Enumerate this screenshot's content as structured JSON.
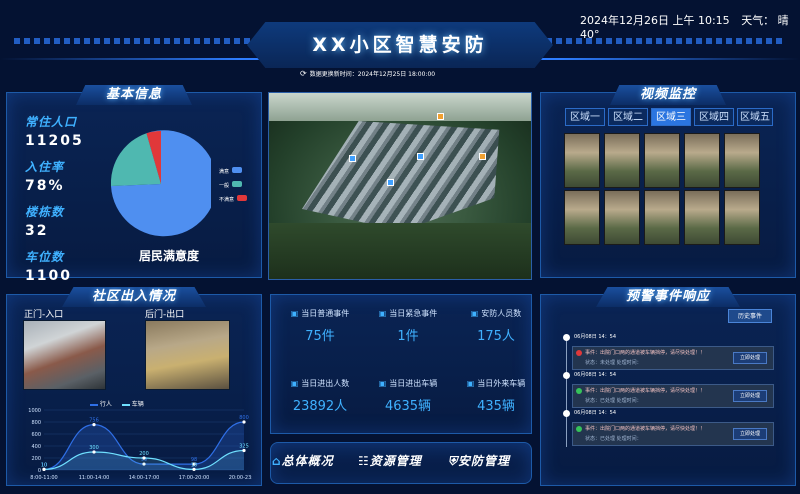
{
  "header": {
    "title": "XX小区智慧安防",
    "datetime": "2024年12月26日  上午  10:15",
    "weather": "天气： 晴  40°",
    "update_time": "数据更换新时间：2024年12月25日 18:00:00"
  },
  "basic_info": {
    "title": "基本信息",
    "stats": [
      {
        "label": "常住人口",
        "value": "11205"
      },
      {
        "label": "入住率",
        "value": "78%"
      },
      {
        "label": "楼栋数",
        "value": "32"
      },
      {
        "label": "车位数",
        "value": "1100"
      }
    ],
    "pie_caption": "居民满意度",
    "pie_legend": [
      "满意",
      "一般",
      "不满意"
    ],
    "colors": {
      "satisfied": "#4f8ff0",
      "normal": "#4fb8b0",
      "unsatisfied": "#e0383a"
    }
  },
  "video": {
    "title": "视频监控",
    "tabs": [
      "区域一",
      "区域二",
      "区域三",
      "区域四",
      "区域五"
    ],
    "active_tab": "区域三"
  },
  "access": {
    "title": "社区出入情况",
    "gate_front": "正门-入口",
    "gate_back": "后门-出口",
    "chart_legend": [
      "行人",
      "车辆"
    ]
  },
  "chart_data": {
    "type": "line",
    "categories": [
      "8:00-11:00",
      "11:00-14:00",
      "14:00-17:00",
      "17:00-20:00",
      "20:00-23:00"
    ],
    "series": [
      {
        "name": "行人",
        "values": [
          10,
          756,
          99,
          98,
          800
        ],
        "color": "#2f6fe6"
      },
      {
        "name": "车辆",
        "values": [
          10,
          300,
          200,
          10,
          325
        ],
        "color": "#6fe0ff"
      }
    ],
    "yticks": [
      0,
      200,
      400,
      600,
      800,
      1000
    ],
    "ylim": [
      0,
      1000
    ]
  },
  "metrics": [
    {
      "label": "当日普通事件",
      "value": "75件"
    },
    {
      "label": "当日紧急事件",
      "value": "1件"
    },
    {
      "label": "安防人员数",
      "value": "175人"
    },
    {
      "label": "当日进出人数",
      "value": "23892人"
    },
    {
      "label": "当日进出车辆",
      "value": "4635辆"
    },
    {
      "label": "当日外来车辆",
      "value": "435辆"
    }
  ],
  "nav": {
    "overview": "总体概况",
    "resources": "资源管理",
    "security": "安防管理"
  },
  "alerts": {
    "title": "预警事件响应",
    "history_button": "历史事件",
    "items": [
      {
        "time": "06月08日  14：54",
        "text": "事件：出院门口两的通道被车辆挡停，请尽快处理！！",
        "sub": "状态：未处理      处理时间：",
        "button": "立即处理"
      },
      {
        "time": "06月08日  14：54",
        "text": "事件：出院门口两的通道被车辆挡停，请尽快处理！！",
        "sub": "状态：已处理      处理时间：",
        "button": "立即处理"
      },
      {
        "time": "06月08日  14：54",
        "text": "事件：出院门口两的通道被车辆挡停，请尽快处理！！",
        "sub": "状态：已处理      处理时间：",
        "button": "立即处理"
      }
    ]
  }
}
